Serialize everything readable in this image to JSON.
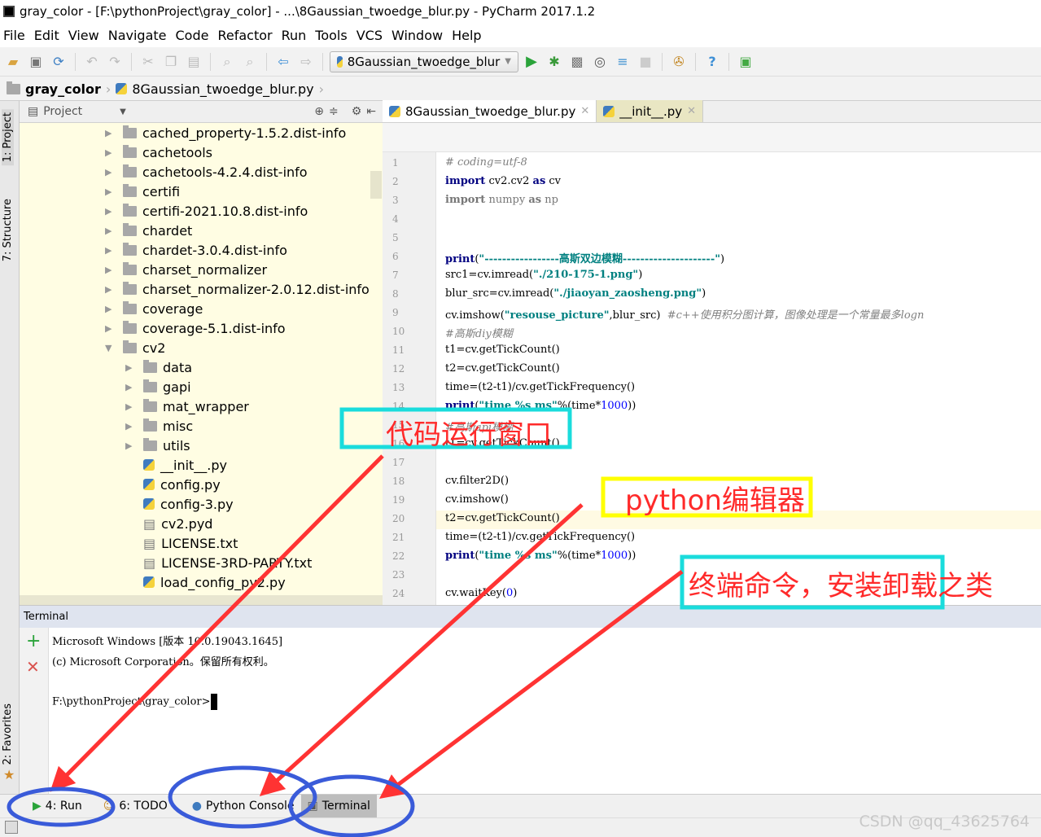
{
  "window": {
    "title": "gray_color - [F:\\pythonProject\\gray_color] - ...\\8Gaussian_twoedge_blur.py - PyCharm 2017.1.2"
  },
  "menu": [
    "File",
    "Edit",
    "View",
    "Navigate",
    "Code",
    "Refactor",
    "Run",
    "Tools",
    "VCS",
    "Window",
    "Help"
  ],
  "toolbar": {
    "run_config": "8Gaussian_twoedge_blur"
  },
  "breadcrumb": {
    "project": "gray_color",
    "file": "8Gaussian_twoedge_blur.py"
  },
  "left_stripe": {
    "project": "1: Project",
    "structure": "7: Structure",
    "favorites": "2: Favorites"
  },
  "project_panel": {
    "title": "Project",
    "items": [
      {
        "label": "cached_property-1.5.2.dist-info",
        "type": "folder",
        "level": 0,
        "expand": "collapsed"
      },
      {
        "label": "cachetools",
        "type": "folder",
        "level": 0,
        "expand": "collapsed"
      },
      {
        "label": "cachetools-4.2.4.dist-info",
        "type": "folder",
        "level": 0,
        "expand": "collapsed"
      },
      {
        "label": "certifi",
        "type": "folder",
        "level": 0,
        "expand": "collapsed"
      },
      {
        "label": "certifi-2021.10.8.dist-info",
        "type": "folder",
        "level": 0,
        "expand": "collapsed"
      },
      {
        "label": "chardet",
        "type": "folder",
        "level": 0,
        "expand": "collapsed"
      },
      {
        "label": "chardet-3.0.4.dist-info",
        "type": "folder",
        "level": 0,
        "expand": "collapsed"
      },
      {
        "label": "charset_normalizer",
        "type": "folder",
        "level": 0,
        "expand": "collapsed"
      },
      {
        "label": "charset_normalizer-2.0.12.dist-info",
        "type": "folder",
        "level": 0,
        "expand": "collapsed"
      },
      {
        "label": "coverage",
        "type": "folder",
        "level": 0,
        "expand": "collapsed"
      },
      {
        "label": "coverage-5.1.dist-info",
        "type": "folder",
        "level": 0,
        "expand": "collapsed"
      },
      {
        "label": "cv2",
        "type": "folder",
        "level": 0,
        "expand": "expanded"
      },
      {
        "label": "data",
        "type": "folder",
        "level": 1,
        "expand": "collapsed"
      },
      {
        "label": "gapi",
        "type": "folder",
        "level": 1,
        "expand": "collapsed"
      },
      {
        "label": "mat_wrapper",
        "type": "folder",
        "level": 1,
        "expand": "collapsed"
      },
      {
        "label": "misc",
        "type": "folder",
        "level": 1,
        "expand": "collapsed"
      },
      {
        "label": "utils",
        "type": "folder",
        "level": 1,
        "expand": "collapsed"
      },
      {
        "label": "__init__.py",
        "type": "py",
        "level": 1
      },
      {
        "label": "config.py",
        "type": "py",
        "level": 1
      },
      {
        "label": "config-3.py",
        "type": "py",
        "level": 1
      },
      {
        "label": "cv2.pyd",
        "type": "file",
        "level": 1
      },
      {
        "label": "LICENSE.txt",
        "type": "txt",
        "level": 1
      },
      {
        "label": "LICENSE-3RD-PARTY.txt",
        "type": "txt",
        "level": 1
      },
      {
        "label": "load_config_py2.py",
        "type": "py",
        "level": 1
      },
      {
        "label": "load_config_py3.py",
        "type": "py",
        "level": 1
      }
    ]
  },
  "editor": {
    "tabs": [
      {
        "label": "8Gaussian_twoedge_blur.py",
        "active": true
      },
      {
        "label": "__init__.py",
        "active": false
      }
    ],
    "current_line": 20,
    "lines": [
      [
        [
          "# coding=utf-8",
          "cm"
        ]
      ],
      [
        [
          "import",
          "kw"
        ],
        [
          " cv2.cv2 ",
          ""
        ],
        [
          "as",
          "kw"
        ],
        [
          " cv",
          ""
        ]
      ],
      [
        [
          "import",
          "kwg"
        ],
        [
          " numpy ",
          "gr"
        ],
        [
          "as",
          "kwg"
        ],
        [
          " np",
          "gr"
        ]
      ],
      [],
      [],
      [
        [
          "print",
          "kw"
        ],
        [
          "(",
          ""
        ],
        [
          "\"-----------------高斯双边模糊---------------------\"",
          "str"
        ],
        [
          ")",
          ""
        ]
      ],
      [
        [
          "src1=cv.imread(",
          ""
        ],
        [
          "\"./210-175-1.png\"",
          "str"
        ],
        [
          ")",
          ""
        ]
      ],
      [
        [
          "blur_src=cv.imread(",
          ""
        ],
        [
          "\"./jiaoyan_zaosheng.png\"",
          "str"
        ],
        [
          ")",
          ""
        ]
      ],
      [
        [
          "cv.imshow(",
          ""
        ],
        [
          "\"resouse_picture\"",
          "str"
        ],
        [
          ",blur_src)  ",
          ""
        ],
        [
          "#c++使用积分图计算，图像处理是一个常量最多logn",
          "cm"
        ]
      ],
      [
        [
          "#高斯diy模糊",
          "cm"
        ]
      ],
      [
        [
          "t1=cv.getTickCount()",
          ""
        ]
      ],
      [
        [
          "t2=cv.getTickCount()",
          ""
        ]
      ],
      [
        [
          "time=(t2-t1)/cv.getTickFrequency()",
          ""
        ]
      ],
      [
        [
          "print",
          "kw"
        ],
        [
          "(",
          ""
        ],
        [
          "\"time %s ms\"",
          "str"
        ],
        [
          "%(time*",
          ""
        ],
        [
          "1000",
          "num"
        ],
        [
          "))",
          ""
        ]
      ],
      [
        [
          "#高斯api模糊",
          "cm"
        ]
      ],
      [
        [
          "t1=cv.getTickCount()",
          ""
        ]
      ],
      [],
      [
        [
          "cv.filter2D()",
          ""
        ]
      ],
      [
        [
          "cv.imshow()",
          ""
        ]
      ],
      [
        [
          "t2=cv.getTickCount()",
          ""
        ]
      ],
      [
        [
          "time=(t2-t1)/cv.getTickFrequency()",
          ""
        ]
      ],
      [
        [
          "print",
          "kw"
        ],
        [
          "(",
          ""
        ],
        [
          "\"time %s ms\"",
          "str"
        ],
        [
          "%(time*",
          ""
        ],
        [
          "1000",
          "num"
        ],
        [
          "))",
          ""
        ]
      ],
      [],
      [
        [
          "cv.waitKey(",
          ""
        ],
        [
          "0",
          "num"
        ],
        [
          ")",
          ""
        ]
      ]
    ]
  },
  "terminal": {
    "title": "Terminal",
    "lines": [
      "Microsoft Windows [版本 10.0.19043.1645]",
      "(c) Microsoft Corporation。保留所有权利。",
      "",
      "F:\\pythonProject\\gray_color>"
    ]
  },
  "bottom_tabs": [
    {
      "label": "4: Run",
      "icon": "run-icon"
    },
    {
      "label": "6: TODO",
      "icon": "todo-icon"
    },
    {
      "label": "Python Console",
      "icon": "python-icon"
    },
    {
      "label": "Terminal",
      "icon": "terminal-icon",
      "active": true
    }
  ],
  "annotations": {
    "run_window": "代码运行窗口",
    "editor": "python编辑器",
    "terminal": "终端命令，安装卸载之类",
    "colors": {
      "cyan": "#1adcdc",
      "yellow": "#ffff00",
      "red": "#ff3333",
      "blue": "#3a5bd9"
    }
  },
  "watermark": "CSDN @qq_43625764"
}
